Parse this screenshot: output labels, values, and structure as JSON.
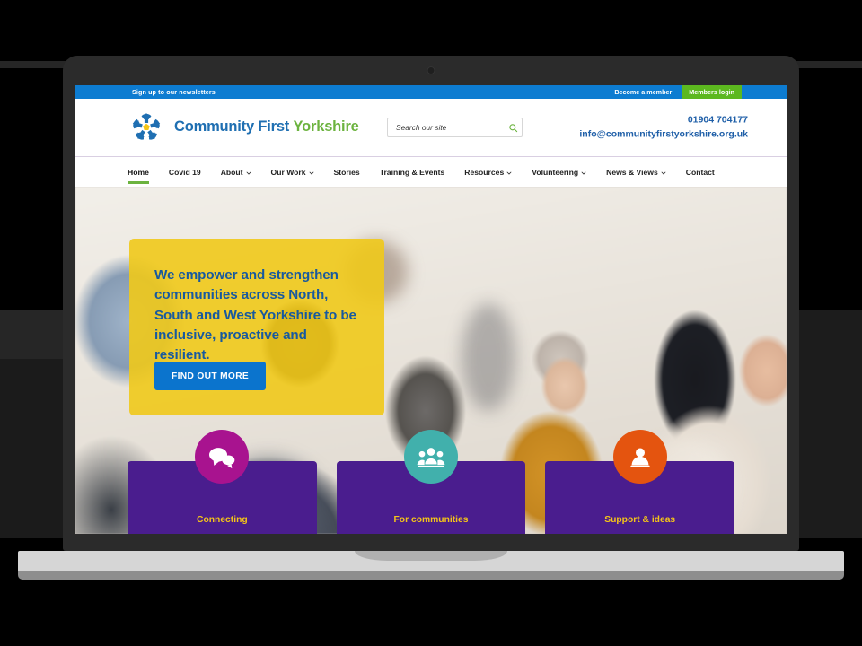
{
  "utility_bar": {
    "newsletter_label": "Sign up to our newsletters",
    "become_member_label": "Become a member",
    "members_login_label": "Members login",
    "bar_color": "#0d7cd1",
    "login_button_color": "#5cb81f"
  },
  "header": {
    "brand_line1": "Community First",
    "brand_line2": "Yorkshire",
    "brand_line1_color": "#1f6fb2",
    "brand_line2_color": "#6cb33f",
    "logo_icon": "pinwheel-rose-logo-icon",
    "search": {
      "placeholder": "Search our site",
      "value": "",
      "icon": "search-icon",
      "icon_color": "#6cb33f"
    },
    "phone": "01904 704177",
    "email": "info@communityfirstyorkshire.org.uk",
    "contact_color": "#1f5fa8"
  },
  "nav": {
    "active_underline_color": "#6cb33f",
    "items": [
      {
        "label": "Home",
        "has_dropdown": false,
        "active": true
      },
      {
        "label": "Covid 19",
        "has_dropdown": false,
        "active": false
      },
      {
        "label": "About",
        "has_dropdown": true,
        "active": false
      },
      {
        "label": "Our Work",
        "has_dropdown": true,
        "active": false
      },
      {
        "label": "Stories",
        "has_dropdown": false,
        "active": false
      },
      {
        "label": "Training & Events",
        "has_dropdown": false,
        "active": false
      },
      {
        "label": "Resources",
        "has_dropdown": true,
        "active": false
      },
      {
        "label": "Volunteering",
        "has_dropdown": true,
        "active": false
      },
      {
        "label": "News & Views",
        "has_dropdown": true,
        "active": false
      },
      {
        "label": "Contact",
        "has_dropdown": false,
        "active": false
      }
    ]
  },
  "hero": {
    "promo": {
      "heading": "We empower and strengthen communities across North, South and West Yorkshire to be inclusive, proactive and resilient.",
      "cta_label": "FIND OUT MORE",
      "panel_color": "#f0c91a",
      "heading_color": "#17599f",
      "cta_color": "#0b74cd"
    },
    "cards": [
      {
        "label": "Connecting",
        "icon": "speech-bubbles-icon",
        "icon_bg": "#a8138f",
        "card_bg": "#4a1d8e",
        "label_color": "#f5c518"
      },
      {
        "label": "For communities",
        "icon": "group-people-icon",
        "icon_bg": "#41b0ac",
        "card_bg": "#4a1d8e",
        "label_color": "#f5c518"
      },
      {
        "label": "Support & ideas",
        "icon": "single-person-icon",
        "icon_bg": "#e4540f",
        "card_bg": "#4a1d8e",
        "label_color": "#f5c518"
      }
    ]
  },
  "device": {
    "type": "laptop-mockup",
    "lid_color": "#2b2b2b",
    "base_color": "#d6d6d6",
    "backdrop_color": "#000000"
  }
}
